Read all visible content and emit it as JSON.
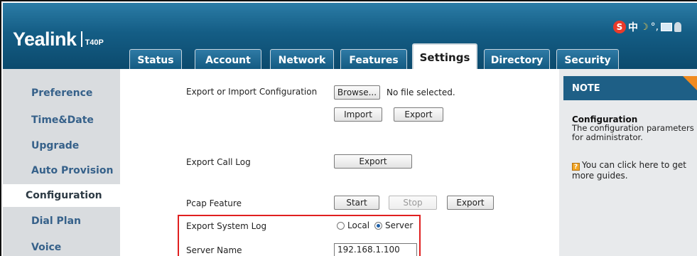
{
  "brand": {
    "name": "Yealink",
    "model": "T40P"
  },
  "ime": {
    "logo_letter": "S",
    "mode": "中"
  },
  "tabs": [
    {
      "label": "Status"
    },
    {
      "label": "Account"
    },
    {
      "label": "Network"
    },
    {
      "label": "Features"
    },
    {
      "label": "Settings"
    },
    {
      "label": "Directory"
    },
    {
      "label": "Security"
    }
  ],
  "active_tab": "Settings",
  "sidebar": {
    "items": [
      {
        "label": "Preference"
      },
      {
        "label": "Time&Date"
      },
      {
        "label": "Upgrade"
      },
      {
        "label": "Auto Provision"
      },
      {
        "label": "Configuration"
      },
      {
        "label": "Dial Plan"
      },
      {
        "label": "Voice"
      }
    ],
    "active": "Configuration"
  },
  "main": {
    "export_import": {
      "label": "Export or Import Configuration",
      "browse_label": "Browse...",
      "file_status": "No file selected.",
      "import_label": "Import",
      "export_label": "Export"
    },
    "call_log": {
      "label": "Export Call Log",
      "export_label": "Export"
    },
    "pcap": {
      "label": "Pcap Feature",
      "start_label": "Start",
      "stop_label": "Stop",
      "export_label": "Export"
    },
    "system_log": {
      "label": "Export System Log",
      "local_label": "Local",
      "server_label": "Server",
      "selected": "Server"
    },
    "server_name": {
      "label": "Server Name",
      "value": "192.168.1.100"
    }
  },
  "note": {
    "heading": "NOTE",
    "title": "Configuration",
    "text": "The configuration parameters for administrator.",
    "guide": "You can click here to get more guides."
  },
  "colors": {
    "header": "#145d85",
    "nav_text": "#36618a",
    "highlight_box": "#e02020",
    "note_accent": "#f08a1f"
  }
}
